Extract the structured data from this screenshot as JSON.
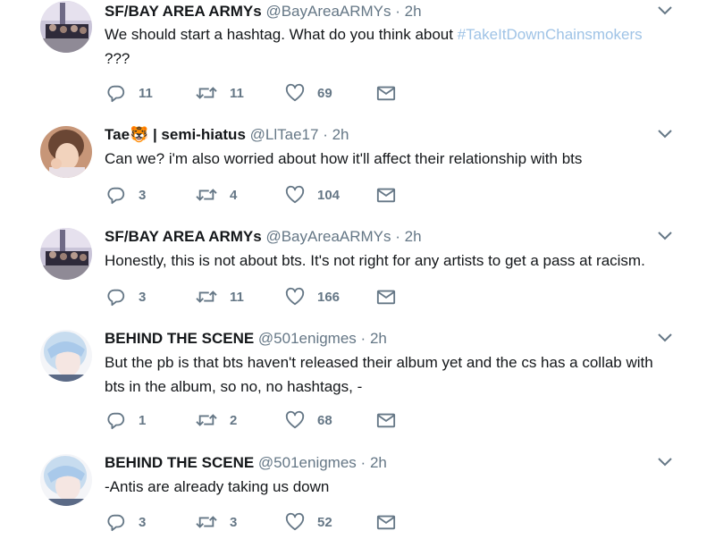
{
  "tweets": [
    {
      "name": "SF/BAY AREA ARMYs",
      "handle": "@BayAreaARMYs",
      "dot": "·",
      "time": "2h",
      "text": "We should start a hashtag. What do you think about ",
      "hashtag": "#TakeItDownChainsmokers",
      "text_after": "???",
      "replies": "11",
      "retweets": "11",
      "likes": "69",
      "avatar": "group-photo"
    },
    {
      "name": "Tae",
      "name_suffix": " | semi-hiatus",
      "emoji": "🐯",
      "handle": "@LlTae17",
      "dot": "·",
      "time": "2h",
      "text": "Can we?  i'm also worried about how it'll affect their relationship with bts",
      "replies": "3",
      "retweets": "4",
      "likes": "104",
      "avatar": "portrait"
    },
    {
      "name": "SF/BAY AREA ARMYs",
      "handle": "@BayAreaARMYs",
      "dot": "·",
      "time": "2h",
      "text": "Honestly, this is not about bts. It's not right for any artists to get a pass at racism.",
      "replies": "3",
      "retweets": "11",
      "likes": "166",
      "avatar": "group-photo"
    },
    {
      "name": "BEHIND THE SCENE",
      "handle": "@501enigmes",
      "dot": "·",
      "time": "2h",
      "text_line1": "But the pb is that bts haven't released their album yet and the cs has a collab with",
      "text_line2": "bts in the album, so no, no hashtags, -",
      "replies": "1",
      "retweets": "2",
      "likes": "68",
      "avatar": "silver-hair-portrait"
    },
    {
      "name": "BEHIND THE SCENE",
      "handle": "@501enigmes",
      "dot": "·",
      "time": "2h",
      "text": "-Antis are already taking us down",
      "replies": "3",
      "retweets": "3",
      "likes": "52",
      "avatar": "silver-hair-portrait"
    }
  ],
  "icons": {
    "reply": "reply-icon",
    "retweet": "retweet-icon",
    "like": "heart-icon",
    "dm": "envelope-icon",
    "more": "chevron-down-icon"
  },
  "colors": {
    "text": "#14171a",
    "muted": "#657786",
    "hashtag": "#9fc3e6"
  }
}
